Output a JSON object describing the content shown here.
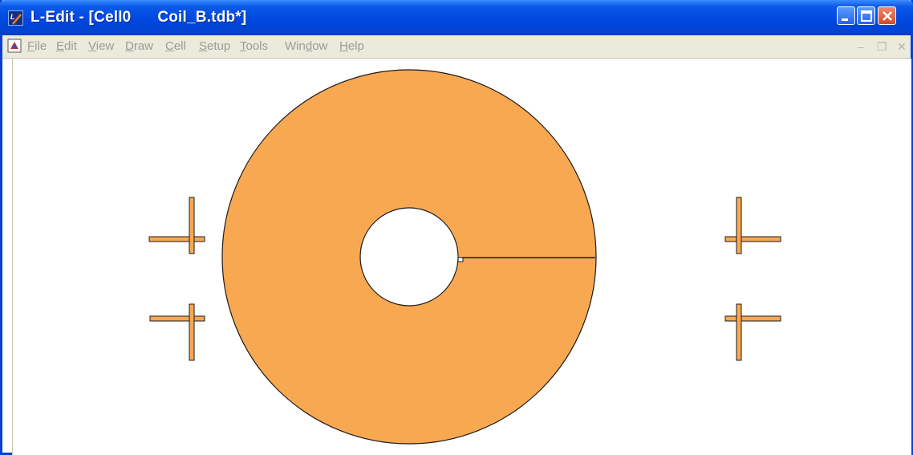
{
  "window": {
    "title": "L-Edit - [Cell0      Coil_B.tdb*]",
    "app_icon": "l-edit-logo-icon",
    "controls": [
      "minimize-icon",
      "maximize-icon",
      "close-icon"
    ]
  },
  "menubar": {
    "items": [
      {
        "label": "File",
        "u": "F",
        "rest": "ile"
      },
      {
        "label": "Edit",
        "u": "E",
        "rest": "dit"
      },
      {
        "label": "View",
        "u": "V",
        "rest": "iew"
      },
      {
        "label": "Draw",
        "u": "D",
        "rest": "raw"
      },
      {
        "label": "Cell",
        "u": "C",
        "rest": "ell"
      },
      {
        "label": "Setup",
        "u": "S",
        "rest": "etup"
      },
      {
        "label": "Tools",
        "u": "T",
        "rest": "ools"
      },
      {
        "label": "Window",
        "pre": "Win",
        "u": "d",
        "rest": "ow"
      },
      {
        "label": "Help",
        "u": "H",
        "rest": "elp"
      }
    ],
    "mdi_controls": [
      "mdi-minimize-icon",
      "mdi-restore-icon",
      "mdi-close-icon"
    ]
  },
  "layout_canvas": {
    "fill_color": "#f9a852",
    "stroke_color": "#1a1a1a",
    "shapes": [
      "coil-ring",
      "coil-inner-hole",
      "coil-slit-line",
      "alignment-marks"
    ]
  }
}
